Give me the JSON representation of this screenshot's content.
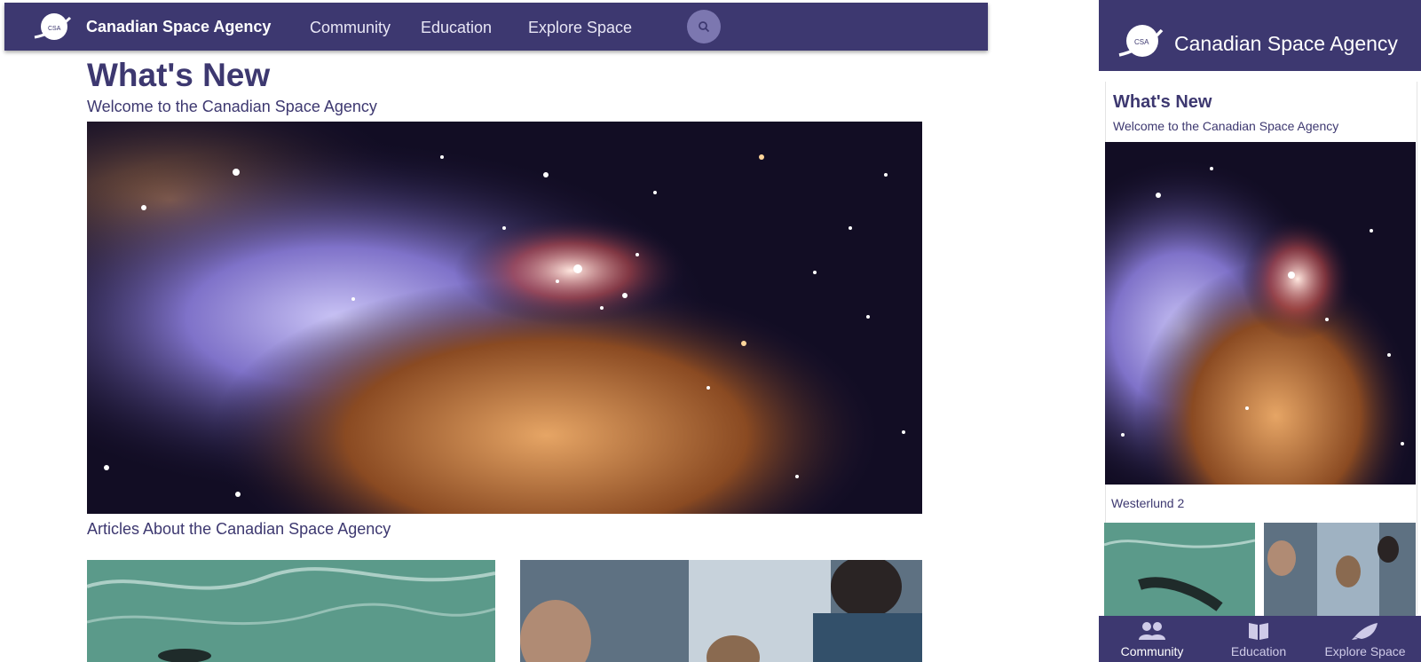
{
  "desktop": {
    "header": {
      "brand": "Canadian Space Agency",
      "logo_text": "CSA",
      "nav": [
        "Community",
        "Education",
        "Explore Space"
      ],
      "search_icon": "search-icon"
    },
    "main": {
      "title": "What's New",
      "subtitle": "Welcome to the Canadian Space Agency",
      "articles_heading": "Articles About the Canadian Space Agency"
    }
  },
  "mobile": {
    "header": {
      "brand": "Canadian Space Agency",
      "logo_text": "CSA"
    },
    "card": {
      "title": "What's New",
      "subtitle": "Welcome to the Canadian Space Agency",
      "caption": "Westerlund 2"
    },
    "bottom_nav": [
      {
        "label": "Community",
        "icon": "people-icon",
        "active": true
      },
      {
        "label": "Education",
        "icon": "book-icon",
        "active": false
      },
      {
        "label": "Explore Space",
        "icon": "rocket-icon",
        "active": false
      }
    ]
  },
  "colors": {
    "primary": "#3d3870",
    "search_bg": "#7c77b0"
  }
}
